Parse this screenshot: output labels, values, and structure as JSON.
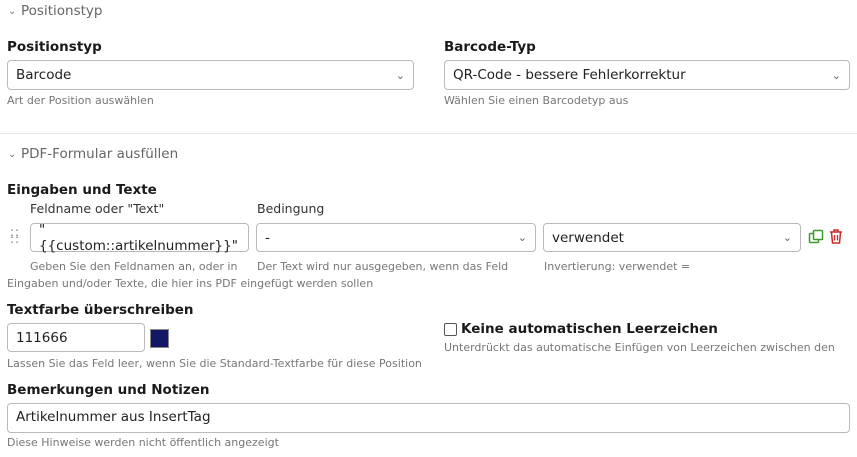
{
  "section_position": {
    "toggle": "Positionstyp",
    "positionstyp": {
      "label": "Positionstyp",
      "value": "Barcode",
      "hint": "Art der Position auswählen"
    },
    "barcode_typ": {
      "label": "Barcode-Typ",
      "value": "QR-Code - bessere Fehlerkorrektur",
      "hint": "Wählen Sie einen Barcodetyp aus"
    }
  },
  "section_pdf": {
    "toggle": "PDF-Formular ausfüllen",
    "group_label": "Eingaben und Texte",
    "col_field": "Feldname oder \"Text\"",
    "col_condition": "Bedingung",
    "row": {
      "field_value": "\"{{custom::artikelnummer}}\"",
      "condition_value": "-",
      "inversion_value": "verwendet"
    },
    "hint_field_1": "Geben Sie den Feldnamen an, oder in",
    "hint_field_2": "Eingaben und/oder Texte, die hier ins PDF eingefügt werden sollen",
    "hint_condition": "Der Text wird nur ausgegeben, wenn das Feld",
    "hint_inversion": "Invertierung: verwendet ="
  },
  "textcolor": {
    "label": "Textfarbe überschreiben",
    "value": "111666",
    "swatch_color": "#111666",
    "hint": "Lassen Sie das Feld leer, wenn Sie die Standard-Textfarbe für diese Position"
  },
  "no_spaces": {
    "label": "Keine automatischen Leerzeichen",
    "hint": "Unterdrückt das automatische Einfügen von Leerzeichen zwischen den"
  },
  "notes": {
    "label": "Bemerkungen und Notizen",
    "value": "Artikelnummer aus InsertTag",
    "hint": "Diese Hinweise werden nicht öffentlich angezeigt"
  },
  "colors": {
    "copy_icon": "#3a9a2a",
    "delete_icon": "#cc2a2a"
  }
}
